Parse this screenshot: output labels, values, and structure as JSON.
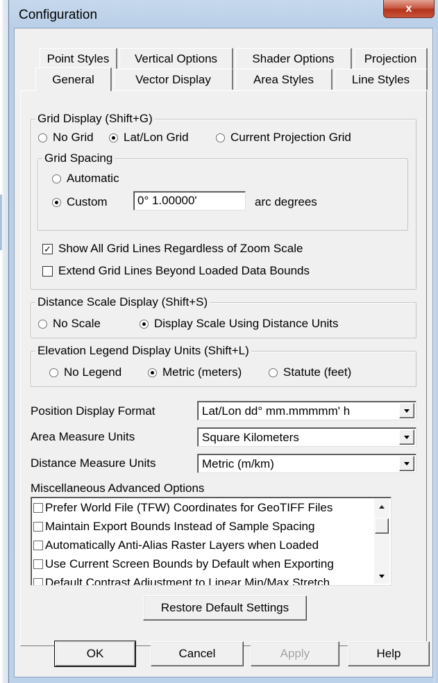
{
  "window": {
    "title": "Configuration",
    "close_glyph": "x"
  },
  "tabs": {
    "row1": [
      "Point Styles",
      "Vertical Options",
      "Shader Options",
      "Projection"
    ],
    "row2": [
      "General",
      "Vector Display",
      "Area Styles",
      "Line Styles"
    ],
    "active": "General"
  },
  "grid_display": {
    "title": "Grid Display (Shift+G)",
    "options": [
      "No Grid",
      "Lat/Lon Grid",
      "Current Projection Grid"
    ],
    "selected": "Lat/Lon Grid",
    "spacing": {
      "title": "Grid Spacing",
      "automatic_label": "Automatic",
      "custom_label": "Custom",
      "selected": "Custom",
      "custom_value": "0° 1.00000'",
      "units_label": "arc degrees"
    },
    "show_all_lines_label": "Show All Grid Lines Regardless of Zoom Scale",
    "show_all_lines_checked": true,
    "extend_lines_label": "Extend Grid Lines Beyond Loaded Data Bounds",
    "extend_lines_checked": false
  },
  "distance_scale": {
    "title": "Distance Scale Display (Shift+S)",
    "options": [
      "No Scale",
      "Display Scale Using Distance Units"
    ],
    "selected": "Display Scale Using Distance Units"
  },
  "elevation_legend": {
    "title": "Elevation Legend Display Units (Shift+L)",
    "options": [
      "No Legend",
      "Metric (meters)",
      "Statute (feet)"
    ],
    "selected": "Metric (meters)"
  },
  "position_format": {
    "label": "Position Display Format",
    "value": "Lat/Lon dd° mm.mmmmm' h"
  },
  "area_units": {
    "label": "Area Measure Units",
    "value": "Square Kilometers"
  },
  "distance_units": {
    "label": "Distance Measure Units",
    "value": "Metric (m/km)"
  },
  "misc": {
    "title": "Miscellaneous Advanced Options",
    "items": [
      "Prefer World File (TFW) Coordinates for GeoTIFF Files",
      "Maintain Export Bounds Instead of Sample Spacing",
      "Automatically Anti-Alias Raster Layers when Loaded",
      "Use Current Screen Bounds by Default when Exporting",
      "Default Contrast Adjustment to Linear Min/Max Stretch"
    ]
  },
  "restore_label": "Restore Default Settings",
  "footer": {
    "ok": "OK",
    "cancel": "Cancel",
    "apply": "Apply",
    "help": "Help"
  }
}
